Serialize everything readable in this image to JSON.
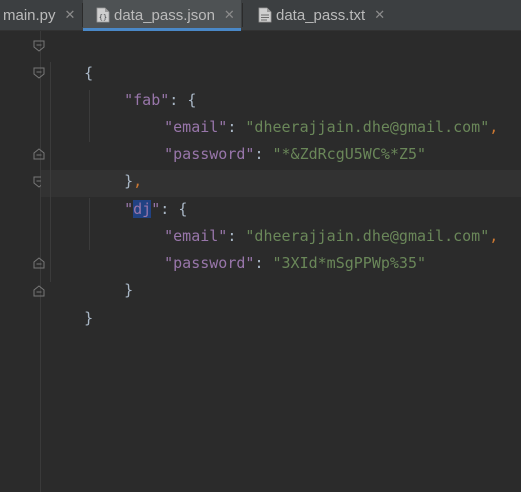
{
  "tabs": [
    {
      "label": "main.py",
      "close": "✕",
      "icon": "python-file-icon",
      "active": false
    },
    {
      "label": "data_pass.json",
      "close": "✕",
      "icon": "json-file-icon",
      "active": true
    },
    {
      "label": "data_pass.txt",
      "close": "✕",
      "icon": "text-file-icon",
      "active": false
    }
  ],
  "code": {
    "open_brace": "{",
    "fab": {
      "key": "\"fab\"",
      "colon": ": ",
      "open": "{"
    },
    "fab_email": {
      "key": "\"email\"",
      "colon": ": ",
      "value": "\"dheerajjain.dhe@gmail.com\"",
      "comma": ","
    },
    "fab_password": {
      "key": "\"password\"",
      "colon": ": ",
      "value": "\"*&ZdRcgU5WC%*Z5\""
    },
    "fab_close": {
      "close": "}",
      "comma": ","
    },
    "dj": {
      "q1": "\"",
      "name": "dj",
      "q2": "\"",
      "colon": ": ",
      "open": "{"
    },
    "dj_email": {
      "key": "\"email\"",
      "colon": ": ",
      "value": "\"dheerajjain.dhe@gmail.com\"",
      "comma": ","
    },
    "dj_password": {
      "key": "\"password\"",
      "colon": ": ",
      "value": "\"3XId*mSgPPWp%35\""
    },
    "dj_close": {
      "close": "}"
    },
    "close_brace": "}"
  },
  "colors": {
    "background": "#2b2b2b",
    "key": "#9876aa",
    "string": "#6a8759",
    "punctuation": "#cc7832",
    "brace": "#a9b7c6",
    "selection": "#214283"
  }
}
